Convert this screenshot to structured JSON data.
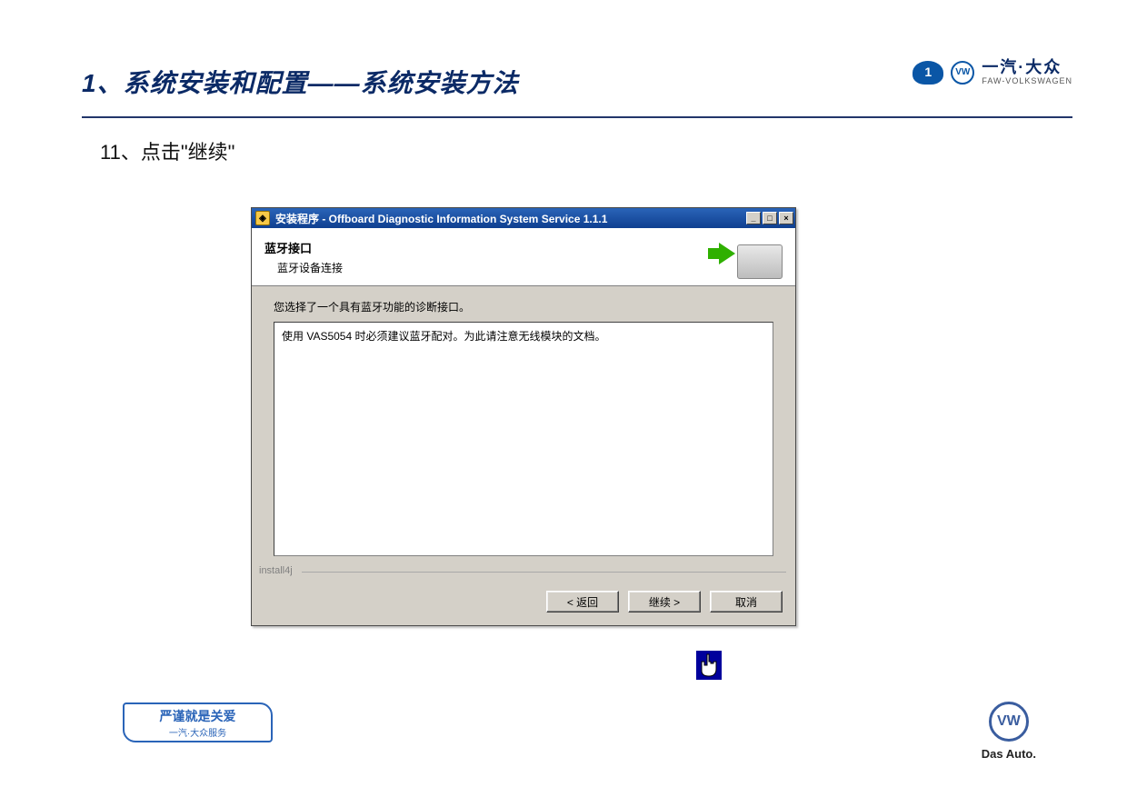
{
  "slide": {
    "title": "1、系统安装和配置——系统安装方法",
    "step_text": "11、点击\"继续\""
  },
  "brand": {
    "cn": "一汽·大众",
    "en": "FAW-VOLKSWAGEN",
    "vw_mark": "VW",
    "das_auto": "Das Auto."
  },
  "dialog": {
    "title": "安装程序 - Offboard Diagnostic Information System Service 1.1.1",
    "header_title": "蓝牙接口",
    "header_sub": "蓝牙设备连接",
    "prompt": "您选择了一个具有蓝牙功能的诊断接口。",
    "body_text": "使用 VAS5054 时必须建议蓝牙配对。为此请注意无线模块的文档。",
    "install4j": "install4j",
    "buttons": {
      "back": "< 返回",
      "next": "继续 >",
      "cancel": "取消"
    },
    "titlebar_icons": {
      "minimize": "_",
      "maximize": "□",
      "close": "×"
    }
  },
  "footer_badge": {
    "line1": "严谨就是关爱",
    "line2": "一汽·大众服务"
  }
}
